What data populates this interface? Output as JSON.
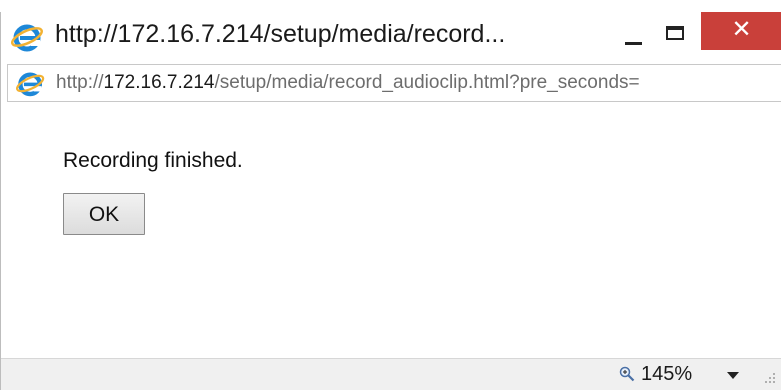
{
  "window": {
    "title": "http://172.16.7.214/setup/media/record...",
    "controls": {
      "minimize_icon": "minimize-icon",
      "maximize_icon": "maximize-icon",
      "close_glyph": "✕",
      "close_color": "#c9403a"
    }
  },
  "address": {
    "prefix": "http://",
    "host": "172.16.7.214",
    "path": "/setup/media/record_audioclip.html?pre_seconds="
  },
  "dialog": {
    "message": "Recording finished.",
    "ok_label": "OK"
  },
  "status": {
    "zoom": "145%"
  },
  "colors": {
    "ie_logo": "#1e88d8",
    "ie_ring": "#f2b233"
  }
}
